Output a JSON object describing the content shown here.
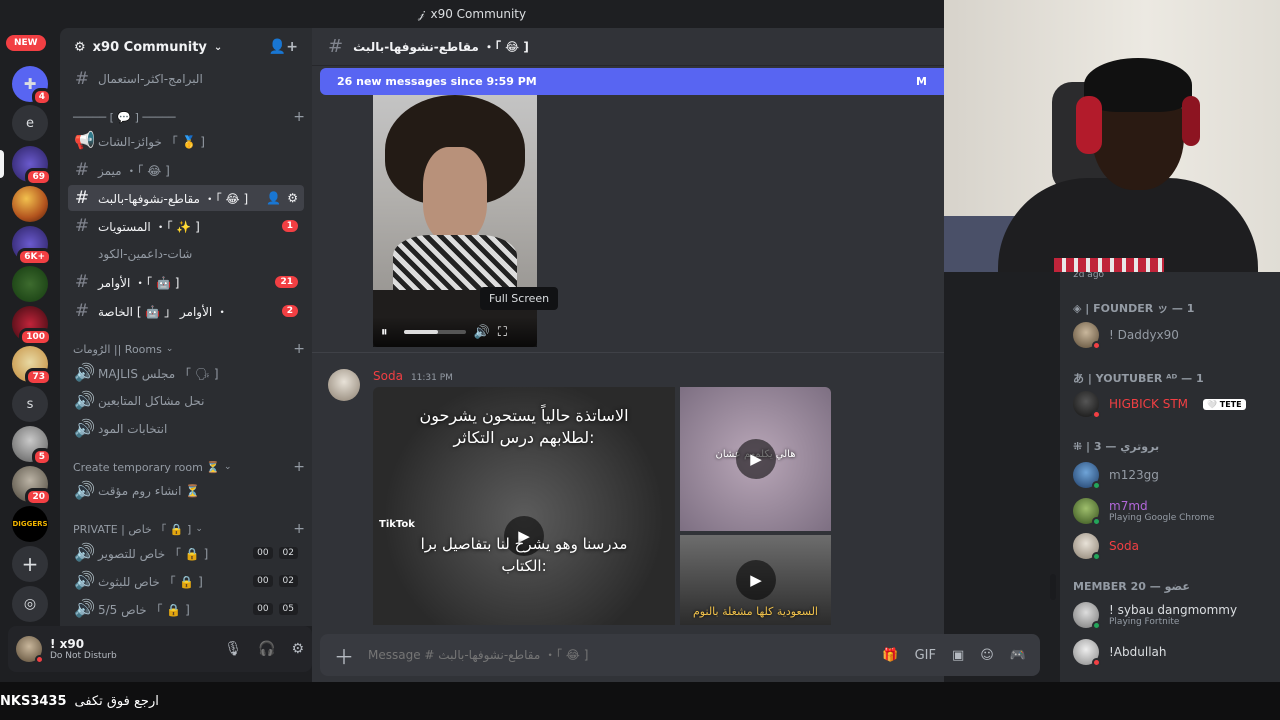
{
  "titlebar": {
    "icon": "discord-icon",
    "title": "x90 Community"
  },
  "rail": {
    "new_label": "NEW",
    "servers": [
      {
        "name": "discord-home",
        "badge": "4"
      },
      {
        "name": "e",
        "letter": "e"
      },
      {
        "name": "server-3",
        "badge": "69"
      },
      {
        "name": "server-4",
        "badge": ""
      },
      {
        "name": "server-5",
        "badge": "6K+"
      },
      {
        "name": "server-6",
        "badge": ""
      },
      {
        "name": "server-7",
        "badge": "100"
      },
      {
        "name": "server-8",
        "badge": "73"
      },
      {
        "name": "s",
        "letter": "s"
      },
      {
        "name": "server-10",
        "badge": "5"
      },
      {
        "name": "server-11",
        "badge": "20"
      },
      {
        "name": "diggers",
        "label": "DIGGERS"
      }
    ]
  },
  "sidebar": {
    "guild_name": "x90 Community",
    "channels": {
      "c1": "البرامج-اكثر-استعمال",
      "sep": "───── [ 💬 ] ─────",
      "c2": "خوائز-الشات 「 🥇 ]",
      "c3": "ميمز ・「 😂 ]",
      "c4": "مقاطع-نشوفها-بالبث ・「 😂 ]",
      "c5": "المستويات ・「 ✨ ]",
      "c6": "شات-داعمين-الكود",
      "c7": "الأوامر ・「 🤖 ]",
      "c8": "الأوامر 「 🤖 ] الخاصة ・"
    },
    "badges": {
      "c5": "1",
      "c7": "21",
      "c8": "2"
    },
    "cat_rooms": "الرُومات || Rooms",
    "rooms": {
      "r1": "MAJLIS مجلس 「 🗣 ]",
      "r2": "نحل مشاكل المتابعين",
      "r3": "انتخابات المود"
    },
    "cat_temp": "Create temporary room ⏳",
    "temp1": "انشاء روم مؤقت ⏳",
    "cat_private": "PRIVATE | خاص 「 🔒 ]",
    "private": [
      {
        "label": "خاص للتصوير 「 🔒 ]",
        "c1": "00",
        "c2": "02"
      },
      {
        "label": "خاص للبثوث 「 🔒 ]",
        "c1": "00",
        "c2": "02"
      },
      {
        "label": "خاص 5/5 「 🔒 ]",
        "c1": "00",
        "c2": "05"
      }
    ]
  },
  "user_panel": {
    "name": "! x90",
    "status": "Do Not Disturb"
  },
  "chat": {
    "channel_title": "مقاطع-نشوفها-بالبث ・「 😂 ]",
    "new_messages": "26 new messages since 9:59 PM",
    "new_mark": "M",
    "tooltip": "Full Screen",
    "video_progress": 0.55,
    "msg2": {
      "author": "Soda",
      "time": "11:31 PM",
      "media_text_top": "الاساتذة حالياً يستحون يشرحون لطلابهم درس التكاثر:",
      "media_text_bottom": "مدرسنا وهو يشرح لنا بتفاصيل برا الكتاب:",
      "tiktok": "TikTok",
      "media_tr_text": "هالي يكلمهم عشان",
      "media_br_text": "السعودية كلها مشغلة بالنوم"
    },
    "composer_placeholder": "Message # مقاطع-نشوفها-بالبث ・「 😂 ]"
  },
  "members": {
    "last_seen": "2d ago",
    "cat_founder": "◈ | FOUNDER ッ — 1",
    "founder": "! Daddyx90",
    "cat_youtuber": "あ | YOUTUBER ᴬᴰ — 1",
    "youtuber": "HIGBICK STM",
    "youtuber_tag": "🤍 TETE",
    "cat_3": "⁜ | 3 — بروتري",
    "m1": "m123gg",
    "m2": "m7md",
    "m2_activity": "Playing Google Chrome",
    "m3": "Soda",
    "cat_member": "MEMBER 20 — عضو",
    "m4": "! sybau dangmommy",
    "m4_activity": "Playing Fortnite",
    "m5": "!Abdullah"
  },
  "ticker": {
    "name": "NKS3435",
    "text": "ارجع فوق تكفى"
  },
  "colors": {
    "accent": "#5865f2",
    "danger": "#f23f43",
    "online": "#23a55a"
  }
}
